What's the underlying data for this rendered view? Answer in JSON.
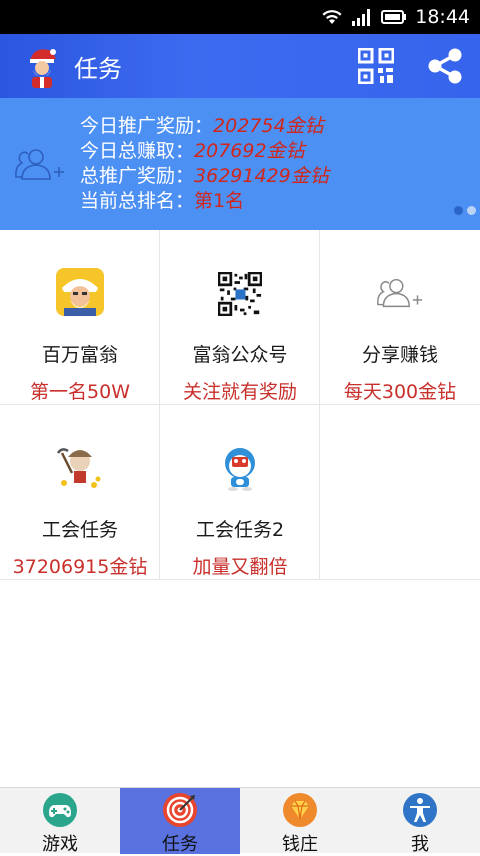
{
  "status_bar": {
    "time": "18:44"
  },
  "header": {
    "title": "任务"
  },
  "stats": [
    {
      "label": "今日推广奖励：",
      "value": "202754金钻",
      "italic": true
    },
    {
      "label": "今日总赚取：",
      "value": "207692金钻",
      "italic": true
    },
    {
      "label": "总推广奖励：",
      "value": "36291429金钻",
      "italic": true
    },
    {
      "label": "当前总排名：",
      "value": "第1名",
      "italic": false
    }
  ],
  "tasks": [
    {
      "name": "百万富翁",
      "sub": "第一名50W",
      "icon": "tycoon-icon"
    },
    {
      "name": "富翁公众号",
      "sub": "关注就有奖励",
      "icon": "qr-code-icon"
    },
    {
      "name": "分享赚钱",
      "sub": "每天300金钻",
      "icon": "add-user-icon"
    },
    {
      "name": "工会任务",
      "sub": "37206915金钻",
      "icon": "gold-miner-icon"
    },
    {
      "name": "工会任务2",
      "sub": "加量又翻倍",
      "icon": "doraemon-icon"
    }
  ],
  "nav": [
    {
      "label": "游戏",
      "icon": "gamepad-icon",
      "active": false
    },
    {
      "label": "任务",
      "icon": "target-icon",
      "active": true
    },
    {
      "label": "钱庄",
      "icon": "diamond-icon",
      "active": false
    },
    {
      "label": "我",
      "icon": "person-icon",
      "active": false
    }
  ]
}
